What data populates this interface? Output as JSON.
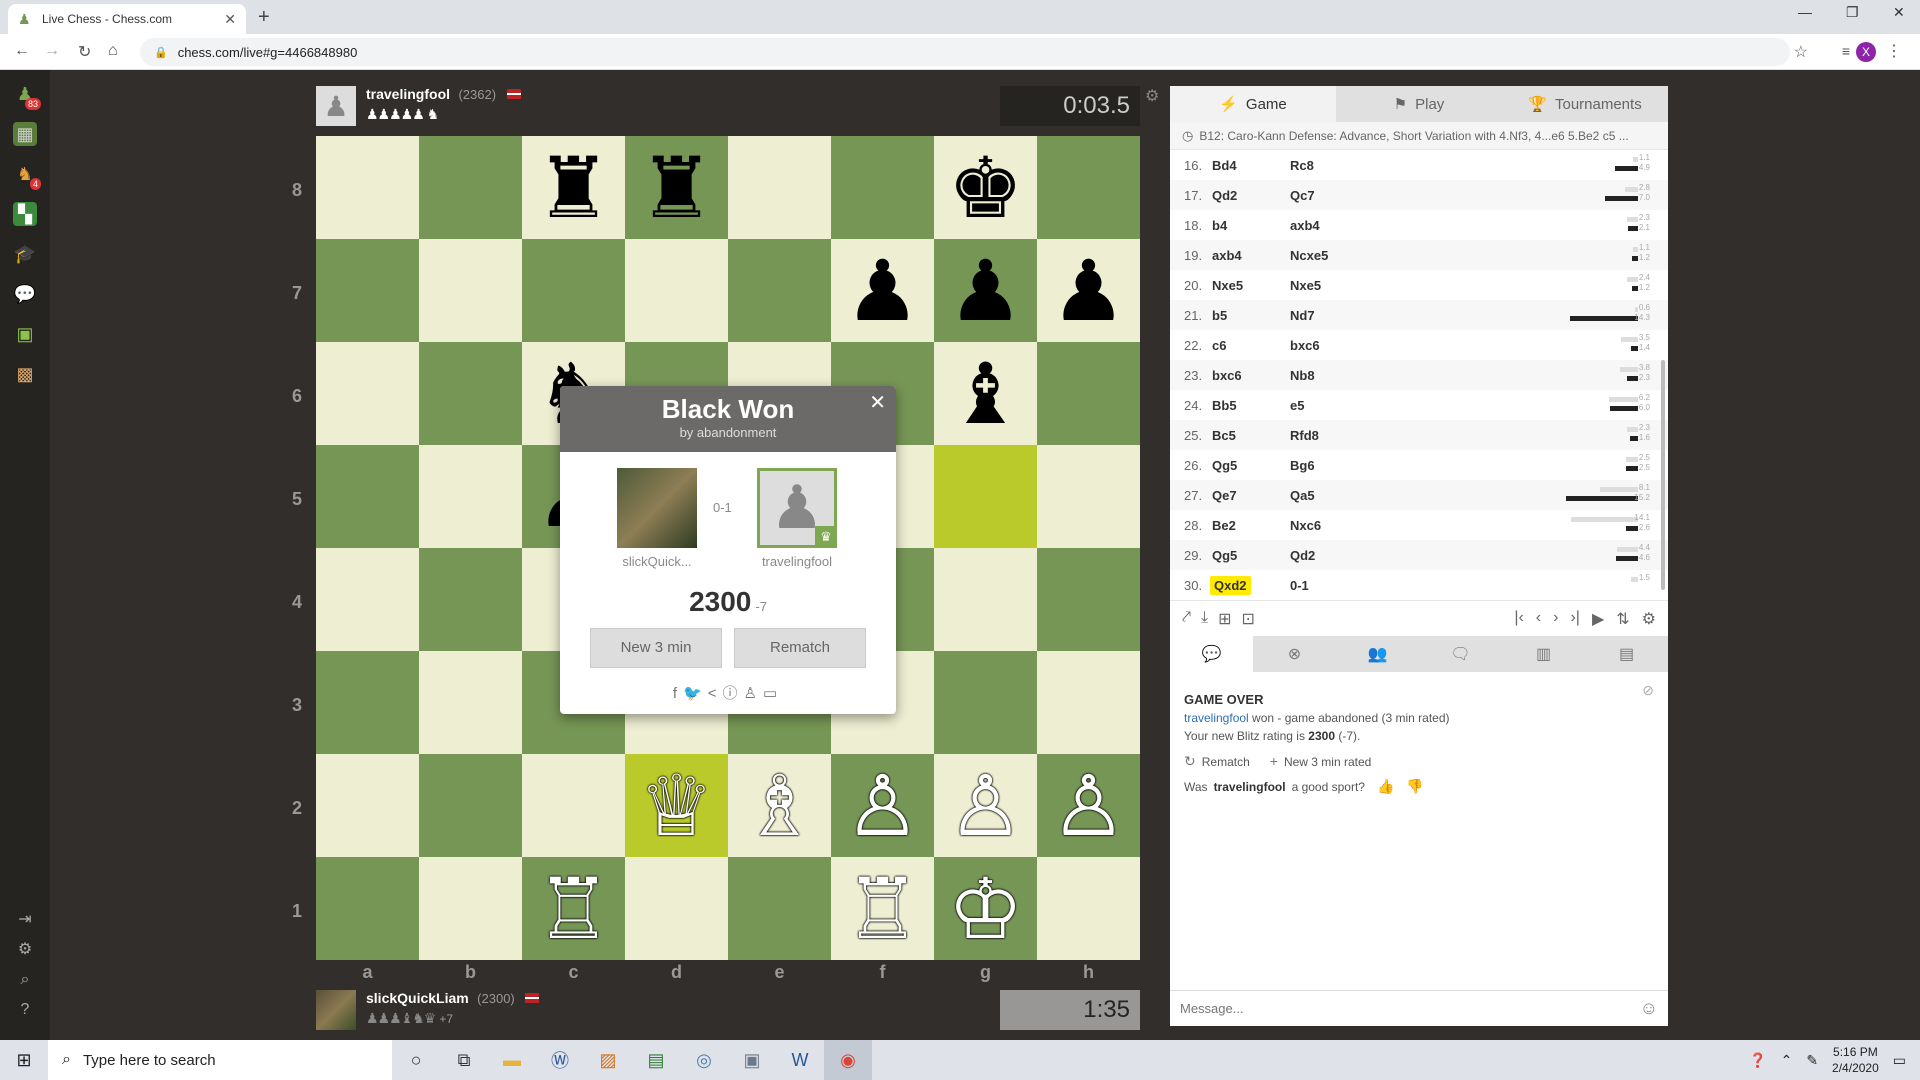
{
  "browser": {
    "tab_title": "Live Chess - Chess.com",
    "url": "chess.com/live#g=4466848980",
    "avatar_letter": "X"
  },
  "sidebar": {
    "items": [
      {
        "icon": "pawn-icon",
        "badge": "83"
      },
      {
        "icon": "puzzle-icon",
        "badge": ""
      },
      {
        "icon": "lessons-icon",
        "badge": "4"
      },
      {
        "icon": "explorer-icon",
        "badge": ""
      },
      {
        "icon": "learn-icon",
        "badge": ""
      },
      {
        "icon": "chat-icon",
        "badge": ""
      },
      {
        "icon": "tv-icon",
        "badge": ""
      },
      {
        "icon": "board-icon",
        "badge": ""
      }
    ]
  },
  "top_player": {
    "name": "travelingfool",
    "rating": "(2362)",
    "captured": "♟♟♟♟♟ ♞",
    "clock": "0:03.5"
  },
  "bottom_player": {
    "name": "slickQuickLiam",
    "rating": "(2300)",
    "captured": "♟♟♟♝♞♛",
    "advantage": "+7",
    "clock": "1:35"
  },
  "board": {
    "ranks": [
      "8",
      "7",
      "6",
      "5",
      "4",
      "3",
      "2",
      "1"
    ],
    "files": [
      "a",
      "b",
      "c",
      "d",
      "e",
      "f",
      "g",
      "h"
    ],
    "highlight": [
      "g5",
      "d2"
    ],
    "pieces": {
      "c8": "♜b",
      "d8": "♜b",
      "g8": "♚b",
      "f7": "♟b",
      "g7": "♟b",
      "h7": "♟b",
      "c6": "♞b",
      "g6": "♝b",
      "c5": "♟b",
      "d2": "♕w",
      "e2": "♗w",
      "f2": "♙w",
      "g2": "♙w",
      "h2": "♙w",
      "c1": "♖w",
      "f1": "♖w",
      "g1": "♔w"
    }
  },
  "modal": {
    "title": "Black Won",
    "subtitle": "by abandonment",
    "left_name": "slickQuick...",
    "right_name": "travelingfool",
    "score": "0-1",
    "rating": "2300",
    "delta": "-7",
    "btn_new": "New 3 min",
    "btn_rematch": "Rematch",
    "share_icons": [
      "facebook-icon",
      "twitter-icon",
      "share-icon",
      "info-icon",
      "analysis-icon",
      "download-icon"
    ]
  },
  "panel": {
    "tabs": [
      "Game",
      "Play",
      "Tournaments"
    ],
    "opening": "B12: Caro-Kann Defense: Advance, Short Variation with 4.Nf3, 4...e6 5.Be2 c5 ...",
    "moves": [
      {
        "n": "16.",
        "w": "Bd4",
        "b": "Rc8",
        "tw": "1.1",
        "tb": "4.9"
      },
      {
        "n": "17.",
        "w": "Qd2",
        "b": "Qc7",
        "tw": "2.8",
        "tb": "7.0"
      },
      {
        "n": "18.",
        "w": "b4",
        "b": "axb4",
        "tw": "2.3",
        "tb": "2.1"
      },
      {
        "n": "19.",
        "w": "axb4",
        "b": "Ncxe5",
        "tw": "1.1",
        "tb": "1.2"
      },
      {
        "n": "20.",
        "w": "Nxe5",
        "b": "Nxe5",
        "tw": "2.4",
        "tb": "1.2"
      },
      {
        "n": "21.",
        "w": "b5",
        "b": "Nd7",
        "tw": "0.6",
        "tb": "14.3"
      },
      {
        "n": "22.",
        "w": "c6",
        "b": "bxc6",
        "tw": "3.5",
        "tb": "1.4"
      },
      {
        "n": "23.",
        "w": "bxc6",
        "b": "Nb8",
        "tw": "3.8",
        "tb": "2.3"
      },
      {
        "n": "24.",
        "w": "Bb5",
        "b": "e5",
        "tw": "6.2",
        "tb": "6.0"
      },
      {
        "n": "25.",
        "w": "Bc5",
        "b": "Rfd8",
        "tw": "2.3",
        "tb": "1.6"
      },
      {
        "n": "26.",
        "w": "Qg5",
        "b": "Bg6",
        "tw": "2.5",
        "tb": "2.5"
      },
      {
        "n": "27.",
        "w": "Qe7",
        "b": "Qa5",
        "tw": "8.1",
        "tb": "15.2"
      },
      {
        "n": "28.",
        "w": "Be2",
        "b": "Nxc6",
        "tw": "14.1",
        "tb": "2.6"
      },
      {
        "n": "29.",
        "w": "Qg5",
        "b": "Qd2",
        "tw": "4.4",
        "tb": "4.6"
      },
      {
        "n": "30.",
        "w": "Qxd2",
        "b": "0-1",
        "tw": "1.5",
        "tb": ""
      }
    ],
    "chat": {
      "title": "GAME OVER",
      "winner": "travelingfool",
      "winner_rest": " won - game abandoned (3 min rated)",
      "rating_prefix": "Your new Blitz rating is ",
      "rating_value": "2300",
      "rating_suffix": " (-7).",
      "rematch": "Rematch",
      "new_game": "New 3 min rated",
      "sport_prefix": "Was ",
      "sport_name": "travelingfool",
      "sport_suffix": " a good sport?",
      "message_placeholder": "Message..."
    }
  },
  "taskbar": {
    "search_placeholder": "Type here to search",
    "time": "5:16 PM",
    "date": "2/4/2020"
  }
}
